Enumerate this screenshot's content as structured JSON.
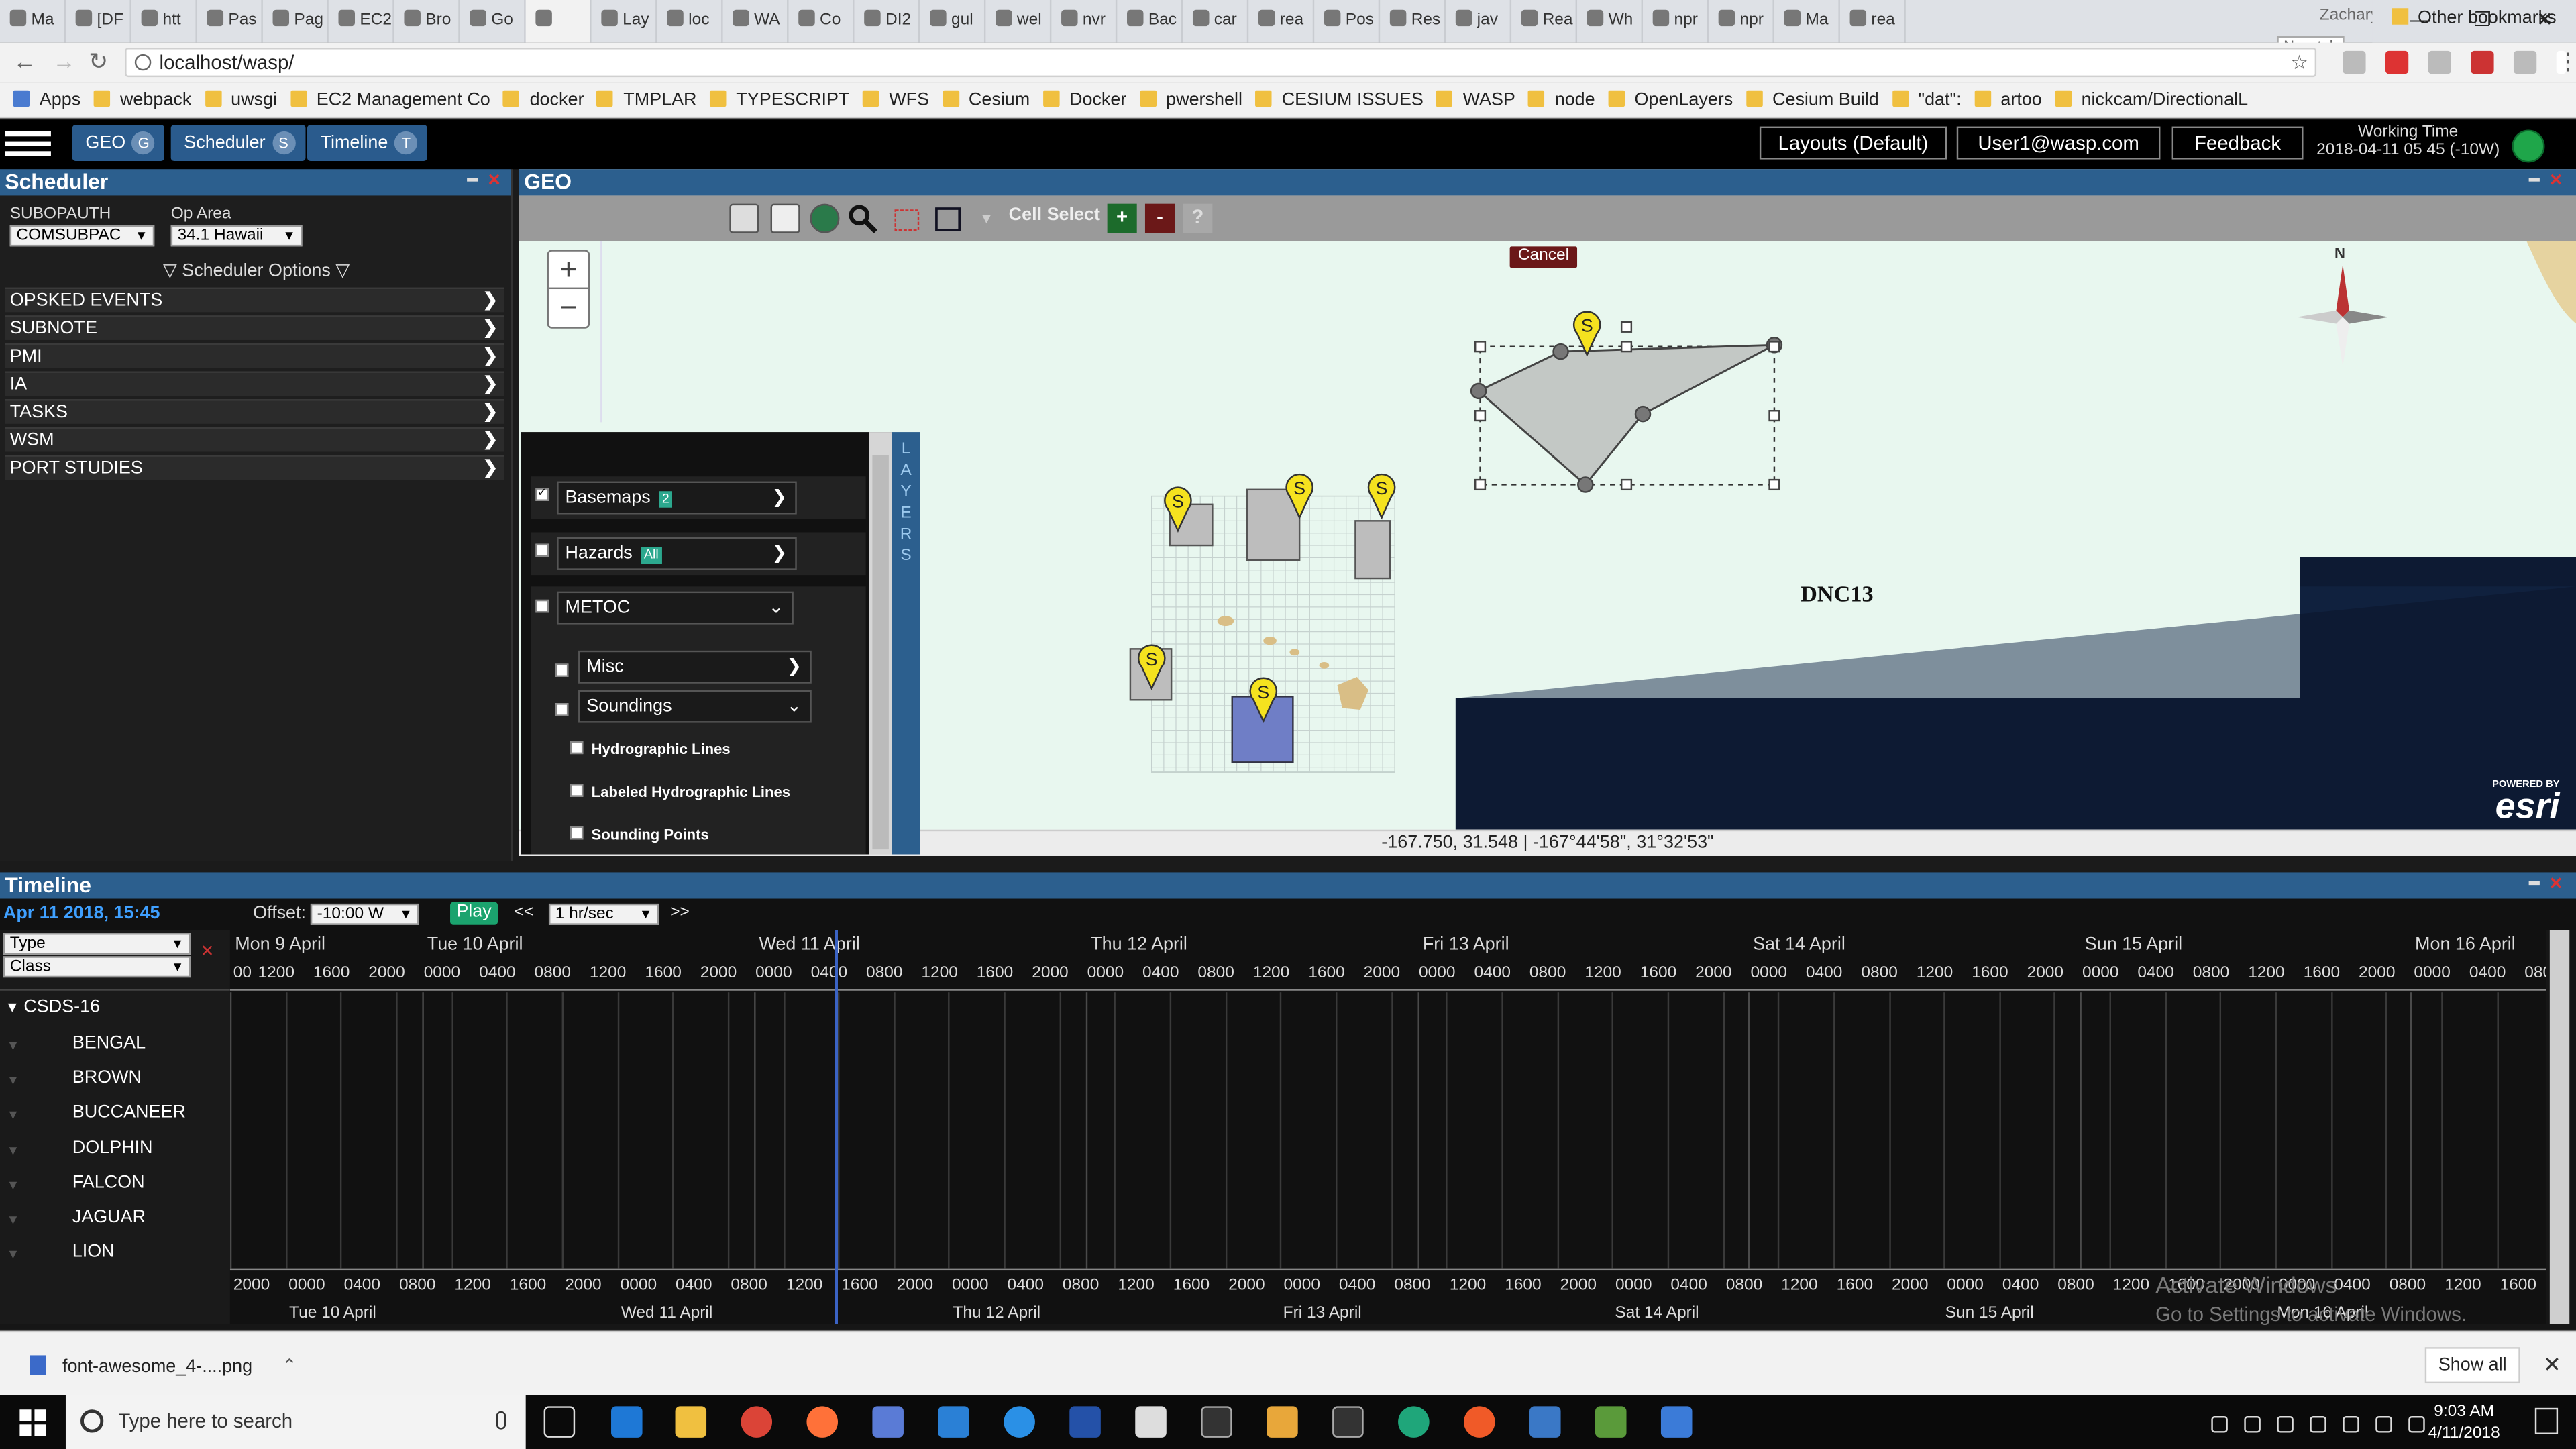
{
  "browser": {
    "tabs": [
      "Ma",
      "[DF",
      "htt",
      "Pas",
      "Pag",
      "EC2",
      "Bro",
      "Go",
      "",
      "Lay",
      "loc",
      "WA",
      "Co",
      "DI2",
      "gul",
      "wel",
      "nvr",
      "Bac",
      "car",
      "rea",
      "Pos",
      "Res",
      "jav",
      "Rea",
      "Wh",
      "npr",
      "npr",
      "Ma",
      "rea"
    ],
    "user_name": "Zachary",
    "new_tab_tip": "New tab",
    "url": "localhost/wasp/",
    "bookmarks": [
      "Apps",
      "webpack",
      "uwsgi",
      "EC2 Management Co",
      "docker",
      "TMPLAR",
      "TYPESCRIPT",
      "WFS",
      "Cesium",
      "Docker",
      "pwershell",
      "CESIUM ISSUES",
      "WASP",
      "node",
      "OpenLayers",
      "Cesium Build",
      "\"dat\":",
      "artoo",
      "nickcam/DirectionalL"
    ],
    "other_bookmarks": "Other bookmarks"
  },
  "header": {
    "tabs": [
      {
        "label": "GEO",
        "key": "G"
      },
      {
        "label": "Scheduler",
        "key": "S"
      },
      {
        "label": "Timeline",
        "key": "T"
      }
    ],
    "layouts": "Layouts (Default)",
    "user": "User1@wasp.com",
    "feedback": "Feedback",
    "working_time_label": "Working Time",
    "working_time": "2018-04-11 05 45 (-10W)"
  },
  "scheduler": {
    "title": "Scheduler",
    "subopauth_label": "SUBOPAUTH",
    "subopauth_value": "COMSUBPAC",
    "oparea_label": "Op Area",
    "oparea_value": "34.1 Hawaii",
    "options": "▽ Scheduler Options ▽",
    "rows": [
      "OPSKED EVENTS",
      "SUBNOTE",
      "PMI",
      "IA",
      "TASKS",
      "WSM",
      "PORT STUDIES"
    ]
  },
  "geo": {
    "title": "GEO",
    "cell_select": "Cell Select",
    "cancel": "Cancel",
    "map_label": "DNC13",
    "north": "N",
    "coords": "-167.750, 31.548 | -167°44'58\", 31°32'53\"",
    "esri_powered": "POWERED BY",
    "esri": "esri",
    "layers_tab": "LAYERS",
    "layers": {
      "basemaps": "Basemaps",
      "basemaps_badge": "2",
      "hazards": "Hazards",
      "hazards_badge": "All",
      "metoc": "METOC",
      "misc": "Misc",
      "soundings": "Soundings",
      "hydro": "Hydrographic Lines",
      "labeled_hydro": "Labeled Hydrographic Lines",
      "sounding_points": "Sounding Points"
    },
    "marker_label": "S"
  },
  "timeline": {
    "title": "Timeline",
    "current": "Apr 11 2018, 15:45",
    "offset_label": "Offset:",
    "offset_value": "-10:00 W",
    "play": "Play",
    "rew": "<<",
    "rate": "1 hr/sec",
    "ffw": ">>",
    "filter_type": "Type",
    "filter_class": "Class",
    "group": "CSDS-16",
    "rows": [
      "BENGAL",
      "BROWN",
      "BUCCANEER",
      "DOLPHIN",
      "FALCON",
      "JAGUAR",
      "LION"
    ],
    "days_top": [
      "Mon 9 April",
      "Tue 10 April",
      "Wed 11 April",
      "Thu 12 April",
      "Fri 13 April",
      "Sat 14 April",
      "Sun 15 April",
      "Mon 16 April"
    ],
    "hours_top": [
      "00",
      "1200",
      "1600",
      "2000",
      "0000",
      "0400",
      "0800",
      "1200",
      "1600",
      "2000",
      "0000",
      "0400",
      "0800",
      "1200",
      "1600",
      "2000",
      "0000",
      "0400",
      "0800",
      "1200",
      "1600",
      "2000",
      "0000",
      "0400",
      "0800",
      "1200",
      "1600",
      "2000",
      "0000",
      "0400",
      "0800",
      "1200",
      "1600",
      "2000",
      "0000",
      "0400",
      "0800",
      "1200",
      "1600",
      "2000",
      "0000",
      "0400",
      "0800"
    ],
    "hours_bottom": [
      "2000",
      "0000",
      "0400",
      "0800",
      "1200",
      "1600",
      "2000",
      "0000",
      "0400",
      "0800",
      "1200",
      "1600",
      "2000",
      "0000",
      "0400",
      "0800",
      "1200",
      "1600",
      "2000",
      "0000",
      "0400",
      "0800",
      "1200",
      "1600",
      "2000",
      "0000",
      "0400",
      "0800",
      "1200",
      "1600",
      "2000",
      "0000",
      "0400",
      "0800",
      "1200",
      "1600",
      "2000",
      "0000",
      "0400",
      "0800",
      "1200",
      "1600"
    ],
    "days_bottom": [
      "Tue 10 April",
      "Wed 11 April",
      "Thu 12 April",
      "Fri 13 April",
      "Sat 14 April",
      "Sun 15 April",
      "Mon 16 April"
    ],
    "watermark1": "Activate Windows",
    "watermark2": "Go to Settings to activate Windows."
  },
  "downloads": {
    "file": "font-awesome_4-....png",
    "show_all": "Show all"
  },
  "taskbar": {
    "search_placeholder": "Type here to search",
    "time": "9:03 AM",
    "date": "4/11/2018"
  }
}
